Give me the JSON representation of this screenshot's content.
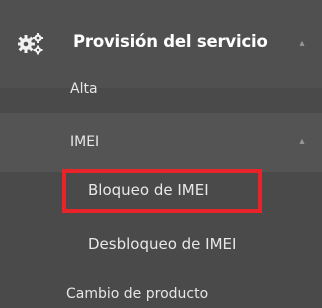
{
  "header": {
    "icon": "gears-icon",
    "title": "Provisión del servicio",
    "chevron": "chevron-up-icon"
  },
  "items": [
    {
      "label": "Alta"
    },
    {
      "label": "IMEI",
      "chevron": "chevron-up-icon"
    },
    {
      "label": "Bloqueo de IMEI",
      "highlighted": true,
      "highlight_color": "#e8232a"
    },
    {
      "label": "Desbloqueo de IMEI"
    },
    {
      "label": "Cambio de producto"
    }
  ],
  "colors": {
    "background": "#4a4a4a",
    "header_bg": "#505050",
    "section_bg": "#545454",
    "text": "#e6e6e6"
  }
}
